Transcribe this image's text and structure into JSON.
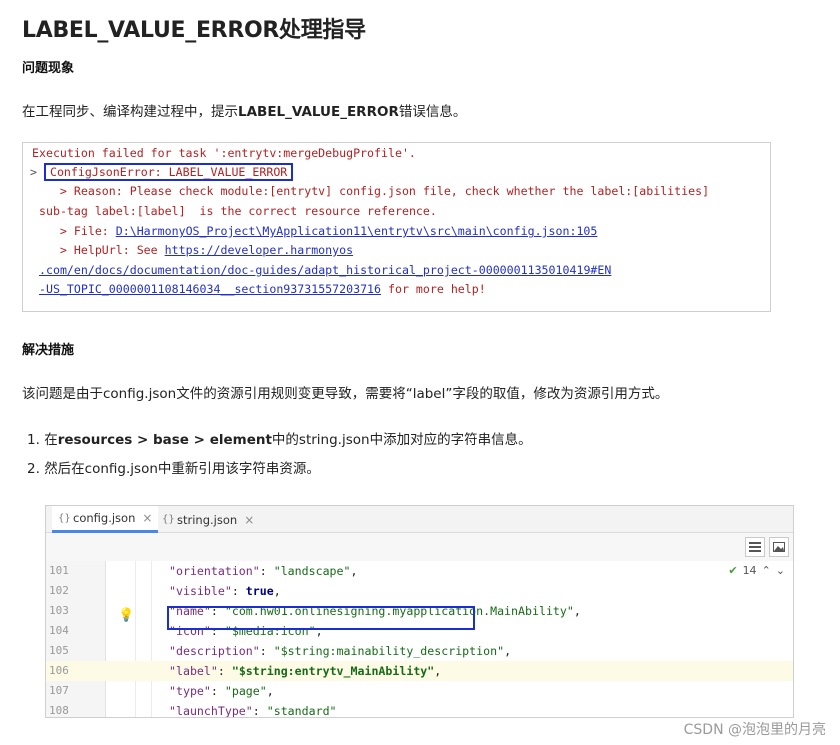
{
  "title": "LABEL_VALUE_ERROR处理指导",
  "symptom": {
    "heading": "问题现象",
    "text_before": "在工程同步、编译构建过程中，提示",
    "text_bold": "LABEL_VALUE_ERROR",
    "text_after": "错误信息。"
  },
  "console": {
    "line1": "Execution failed for task ':entrytv:mergeDebugProfile'.",
    "prompt": ">",
    "error": "ConfigJsonError: LABEL_VALUE_ERROR",
    "reason1": "    > Reason: Please check module:[entrytv] config.json file, check whether the label:[abilities]",
    "reason2": "sub-tag label:[label]  is the correct resource reference.",
    "file_prefix": "    > File: ",
    "file_link": "D:\\HarmonyOS_Project\\MyApplication11\\entrytv\\src\\main\\config.json:105",
    "help_prefix": "    > HelpUrl: See ",
    "help_link1": "https://developer.harmonyos",
    "help_link2": ".com/en/docs/documentation/doc-guides/adapt_historical_project-0000001135010419#EN",
    "help_link3": "-US_TOPIC_0000001108146034__section93731557203716",
    "help_suffix": " for more help!"
  },
  "solution": {
    "heading": "解决措施",
    "text": "该问题是由于config.json文件的资源引用规则变更导致，需要将“label”字段的取值，修改为资源引用方式。",
    "steps": [
      {
        "num": "1.",
        "before": "在",
        "b1": "resources",
        "sep1": " > ",
        "b2": "base",
        "sep2": " > ",
        "b3": "element",
        "after": "中的string.json中添加对应的字符串信息。"
      },
      {
        "num": "2.",
        "text": "然后在config.json中重新引用该字符串资源。"
      }
    ]
  },
  "editor": {
    "tabs": [
      {
        "label": "config.json",
        "active": true
      },
      {
        "label": "string.json",
        "active": false
      }
    ],
    "close_glyph": "×",
    "inspection_count": "14",
    "lines": [
      {
        "num": "101",
        "key": "\"orientation\"",
        "value": "\"landscape\"",
        "tail": ","
      },
      {
        "num": "102",
        "key": "\"visible\"",
        "value": "true",
        "tail": ",",
        "keyword": true
      },
      {
        "num": "103",
        "key": "\"name\"",
        "value": "\"com.hw01.onlinesigning.myapplication.MainAbility\"",
        "tail": ","
      },
      {
        "num": "104",
        "key": "\"icon\"",
        "value": "\"$media:icon\"",
        "tail": ","
      },
      {
        "num": "105",
        "key": "\"description\"",
        "value": "\"$string:mainability_description\"",
        "tail": ","
      },
      {
        "num": "106",
        "key": "\"label\"",
        "value": "\"$string:entrytv_MainAbility\"",
        "tail": ",",
        "highlight": true
      },
      {
        "num": "107",
        "key": "\"type\"",
        "value": "\"page\"",
        "tail": ","
      },
      {
        "num": "108",
        "key": "\"launchType\"",
        "value": "\"standard\"",
        "tail": ""
      }
    ]
  },
  "watermark": "CSDN @泡泡里的月亮",
  "colors": {
    "error_red": "#b22222",
    "link_blue": "#2230c8",
    "box_blue": "#1a2fd1",
    "string_green": "#176b17",
    "key_purple": "#7a2b7e"
  }
}
